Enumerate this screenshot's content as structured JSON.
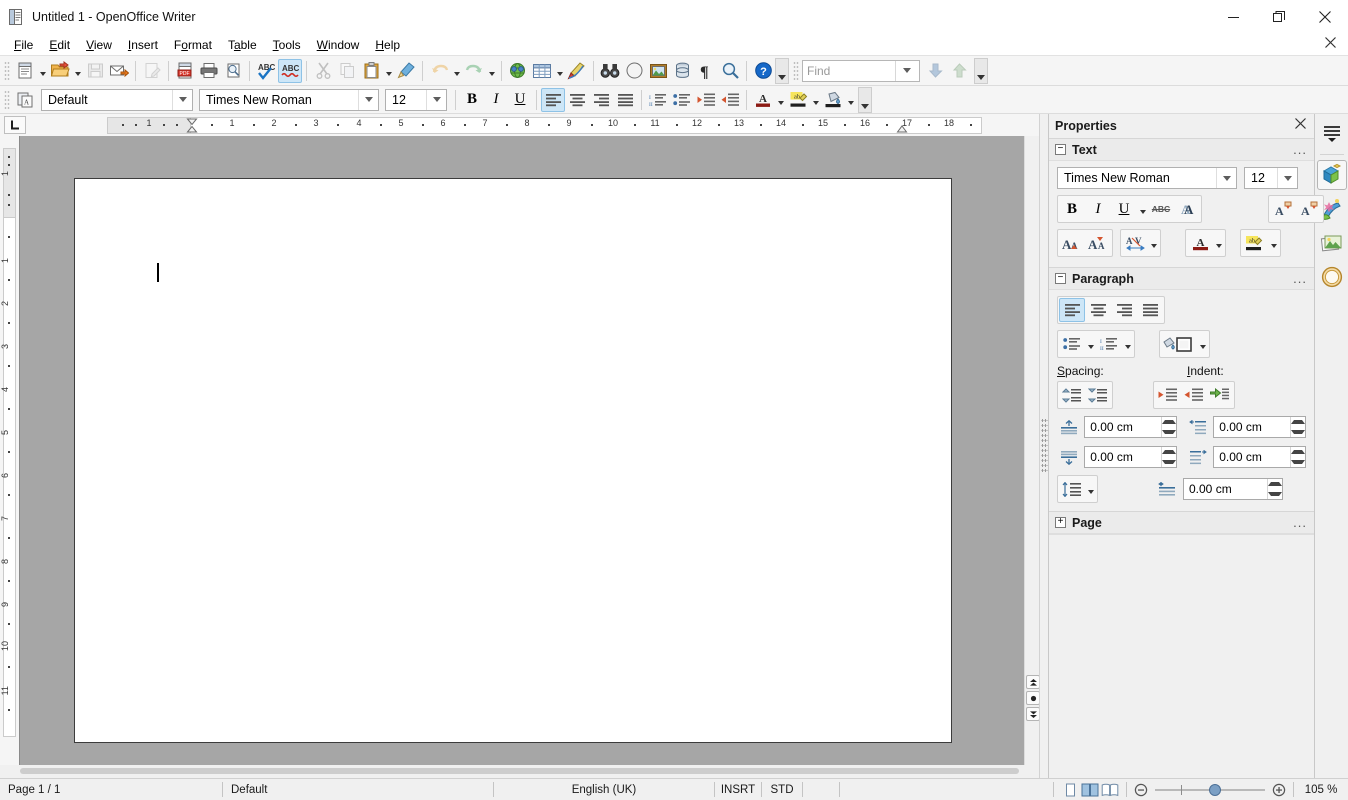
{
  "window": {
    "title": "Untitled 1 - OpenOffice Writer",
    "app_icon": "writer-document-icon",
    "minimize_label": "Minimize",
    "restore_label": "Restore",
    "close_label": "Close",
    "doc_close_label": "Close Document"
  },
  "menubar": {
    "items": [
      {
        "label": "File",
        "accel": "F"
      },
      {
        "label": "Edit",
        "accel": "E"
      },
      {
        "label": "View",
        "accel": "V"
      },
      {
        "label": "Insert",
        "accel": "I"
      },
      {
        "label": "Format",
        "accel": "o"
      },
      {
        "label": "Table",
        "accel": "a"
      },
      {
        "label": "Tools",
        "accel": "T"
      },
      {
        "label": "Window",
        "accel": "W"
      },
      {
        "label": "Help",
        "accel": "H"
      }
    ]
  },
  "standard_toolbar": {
    "items": [
      {
        "name": "new-document-button",
        "tip": "New",
        "icon": "new-doc-icon",
        "dropdown": true,
        "state": "enabled"
      },
      {
        "name": "open-button",
        "tip": "Open",
        "icon": "open-folder-icon",
        "dropdown": true,
        "state": "enabled"
      },
      {
        "name": "save-button",
        "tip": "Save",
        "icon": "floppy-disk-icon",
        "state": "disabled"
      },
      {
        "name": "email-document-button",
        "tip": "E-mail Document",
        "icon": "envelope-arrow-icon",
        "state": "enabled"
      },
      {
        "name": "edit-file-button",
        "tip": "Edit File",
        "icon": "pencil-page-icon",
        "state": "disabled"
      },
      {
        "name": "export-pdf-button",
        "tip": "Export Directly as PDF",
        "icon": "pdf-icon",
        "state": "enabled"
      },
      {
        "name": "print-button",
        "tip": "Print File Directly",
        "icon": "printer-icon",
        "state": "enabled"
      },
      {
        "name": "print-preview-button",
        "tip": "Page Preview",
        "icon": "page-preview-icon",
        "state": "enabled"
      },
      {
        "name": "spelling-button",
        "tip": "Spelling and Grammar",
        "icon": "abc-check-icon",
        "state": "enabled"
      },
      {
        "name": "autospellcheck-button",
        "tip": "AutoSpellcheck",
        "icon": "abc-underline-icon",
        "state": "active"
      },
      {
        "name": "cut-button",
        "tip": "Cut",
        "icon": "scissors-icon",
        "state": "disabled"
      },
      {
        "name": "copy-button",
        "tip": "Copy",
        "icon": "copy-icon",
        "state": "disabled"
      },
      {
        "name": "paste-button",
        "tip": "Paste",
        "icon": "clipboard-icon",
        "dropdown": true,
        "state": "enabled"
      },
      {
        "name": "clone-formatting-button",
        "tip": "Clone Formatting",
        "icon": "paintbrush-icon",
        "state": "enabled"
      },
      {
        "name": "undo-button",
        "tip": "Undo",
        "icon": "undo-arrow-icon",
        "dropdown": true,
        "state": "disabled"
      },
      {
        "name": "redo-button",
        "tip": "Redo",
        "icon": "redo-arrow-icon",
        "dropdown": true,
        "state": "disabled"
      },
      {
        "name": "hyperlink-button",
        "tip": "Hyperlink",
        "icon": "globe-icon",
        "state": "enabled"
      },
      {
        "name": "insert-table-button",
        "tip": "Table",
        "icon": "table-grid-icon",
        "dropdown": true,
        "state": "enabled"
      },
      {
        "name": "show-draw-functions-button",
        "tip": "Show Draw Functions",
        "icon": "pencil-draw-icon",
        "state": "enabled"
      },
      {
        "name": "find-replace-button",
        "tip": "Find & Replace",
        "icon": "binoculars-icon",
        "state": "enabled"
      },
      {
        "name": "navigator-button",
        "tip": "Navigator",
        "icon": "compass-icon",
        "state": "enabled"
      },
      {
        "name": "gallery-button",
        "tip": "Gallery",
        "icon": "picture-frame-icon",
        "state": "enabled"
      },
      {
        "name": "data-sources-button",
        "tip": "Data Sources",
        "icon": "database-icon",
        "state": "enabled"
      },
      {
        "name": "formatting-marks-button",
        "tip": "Formatting Marks",
        "icon": "pilcrow-icon",
        "state": "enabled"
      },
      {
        "name": "zoom-button",
        "tip": "Zoom",
        "icon": "magnifier-icon",
        "state": "enabled"
      },
      {
        "name": "help-button",
        "tip": "OpenOffice Help",
        "icon": "help-circle-icon",
        "state": "enabled"
      }
    ],
    "find": {
      "name": "find-toolbar-input",
      "placeholder": "Find",
      "value": "",
      "find-next-label": "Find Next",
      "find-previous-label": "Find Previous"
    }
  },
  "formatting_toolbar": {
    "paragraph_style": {
      "value": "Default",
      "name": "paragraph-style-combo"
    },
    "font_name": {
      "value": "Times New Roman",
      "name": "font-name-combo"
    },
    "font_size": {
      "value": "12",
      "name": "font-size-combo"
    },
    "buttons": [
      {
        "name": "bold-button",
        "label": "B",
        "state": "enabled"
      },
      {
        "name": "italic-button",
        "label": "I",
        "state": "enabled"
      },
      {
        "name": "underline-button",
        "label": "U",
        "state": "enabled"
      },
      {
        "name": "align-left-button",
        "label": "Align Left",
        "state": "active"
      },
      {
        "name": "align-center-button",
        "label": "Centered",
        "state": "enabled"
      },
      {
        "name": "align-right-button",
        "label": "Align Right",
        "state": "enabled"
      },
      {
        "name": "justified-button",
        "label": "Justified",
        "state": "enabled"
      },
      {
        "name": "ordered-list-button",
        "label": "Numbering On/Off",
        "state": "enabled"
      },
      {
        "name": "unordered-list-button",
        "label": "Bullets On/Off",
        "state": "enabled"
      },
      {
        "name": "increase-indent-button",
        "label": "Increase Indent",
        "state": "enabled"
      },
      {
        "name": "decrease-indent-button",
        "label": "Decrease Indent",
        "state": "enabled"
      },
      {
        "name": "font-color-button",
        "label": "Font Color",
        "state": "enabled"
      },
      {
        "name": "highlighting-button",
        "label": "Highlighting",
        "state": "enabled"
      },
      {
        "name": "background-color-button",
        "label": "Background Color",
        "state": "enabled"
      }
    ]
  },
  "ruler": {
    "horizontal_unit": "cm",
    "horizontal_ticks": [
      "1",
      "1",
      "2",
      "3",
      "4",
      "5",
      "6",
      "7",
      "8",
      "9",
      "10",
      "11",
      "12",
      "13",
      "14",
      "15",
      "16",
      "17",
      "18"
    ],
    "vertical_ticks": [
      "1",
      "1",
      "2",
      "3",
      "4",
      "5",
      "6",
      "7",
      "8",
      "9",
      "10",
      "11"
    ],
    "tab_selector": "left-tab-stop"
  },
  "document": {
    "page_label": "blank-page",
    "content": "",
    "caret_visible": true
  },
  "sidebar": {
    "title": "Properties",
    "close_label": "Close Sidebar Deck",
    "panels": [
      {
        "name": "text-panel",
        "title": "Text",
        "expanded": true,
        "more_options": "...",
        "font_name": {
          "value": "Times New Roman",
          "name": "sidebar-font-name-combo"
        },
        "font_size": {
          "value": "12",
          "name": "sidebar-font-size-combo"
        },
        "buttons": [
          {
            "name": "sidebar-bold-button",
            "label": "B"
          },
          {
            "name": "sidebar-italic-button",
            "label": "I"
          },
          {
            "name": "sidebar-underline-button",
            "label": "U"
          },
          {
            "name": "sidebar-strikethrough-button",
            "label": "ABC"
          },
          {
            "name": "sidebar-shadow-button",
            "label": "A"
          },
          {
            "name": "sidebar-superscript-button",
            "label": "Superscript"
          },
          {
            "name": "sidebar-subscript-button",
            "label": "Subscript"
          },
          {
            "name": "sidebar-increase-font-button",
            "label": "Increase Font Size"
          },
          {
            "name": "sidebar-decrease-font-button",
            "label": "Decrease Font Size"
          },
          {
            "name": "sidebar-character-spacing-button",
            "label": "Character Spacing"
          },
          {
            "name": "sidebar-font-color-button",
            "label": "Font Color"
          },
          {
            "name": "sidebar-highlighting-button",
            "label": "Highlighting"
          }
        ]
      },
      {
        "name": "paragraph-panel",
        "title": "Paragraph",
        "expanded": true,
        "more_options": "...",
        "align_buttons": [
          {
            "name": "sidebar-align-left-button",
            "label": "Align Left",
            "state": "active"
          },
          {
            "name": "sidebar-align-center-button",
            "label": "Center",
            "state": "enabled"
          },
          {
            "name": "sidebar-align-right-button",
            "label": "Align Right",
            "state": "enabled"
          },
          {
            "name": "sidebar-justify-button",
            "label": "Justified",
            "state": "enabled"
          }
        ],
        "list_buttons": [
          {
            "name": "sidebar-bullet-list-button",
            "label": "Unordered List"
          },
          {
            "name": "sidebar-numbered-list-button",
            "label": "Ordered List"
          },
          {
            "name": "sidebar-paragraph-background-button",
            "label": "Paragraph Background"
          }
        ],
        "spacing_label": "Spacing:",
        "spacing_accel": "S",
        "indent_label": "Indent:",
        "indent_accel": "I",
        "spacing_toggle_buttons": [
          {
            "name": "increase-paragraph-spacing-button",
            "label": "Increase Paragraph Spacing"
          },
          {
            "name": "decrease-paragraph-spacing-button",
            "label": "Decrease Paragraph Spacing"
          }
        ],
        "indent_toggle_buttons": [
          {
            "name": "increase-indent-sidebar-button",
            "label": "Increase Indent"
          },
          {
            "name": "decrease-indent-sidebar-button",
            "label": "Decrease Indent"
          },
          {
            "name": "hanging-indent-button",
            "label": "Switch to Hanging Indent"
          }
        ],
        "fields": [
          {
            "name": "above-paragraph-spacing-field",
            "label": "Above Paragraph Spacing",
            "value": "0.00 cm"
          },
          {
            "name": "below-paragraph-spacing-field",
            "label": "Below Paragraph Spacing",
            "value": "0.00 cm"
          },
          {
            "name": "before-text-indent-field",
            "label": "Before Text Indent",
            "value": "0.00 cm"
          },
          {
            "name": "after-text-indent-field",
            "label": "After Text Indent",
            "value": "0.00 cm"
          },
          {
            "name": "first-line-indent-field",
            "label": "First Line Indent",
            "value": "0.00 cm"
          }
        ],
        "line_spacing_button": {
          "name": "line-spacing-button",
          "label": "Line Spacing"
        }
      },
      {
        "name": "page-panel",
        "title": "Page",
        "expanded": false,
        "more_options": "..."
      }
    ],
    "rail": [
      {
        "name": "sidebar-settings-button",
        "icon": "hamburger-menu-icon",
        "selected": false
      },
      {
        "name": "sidebar-tab-properties",
        "icon": "properties-cube-icon",
        "selected": true
      },
      {
        "name": "sidebar-tab-styles",
        "icon": "styles-paint-icon",
        "selected": false
      },
      {
        "name": "sidebar-tab-gallery",
        "icon": "gallery-photos-icon",
        "selected": false
      },
      {
        "name": "sidebar-tab-navigator",
        "icon": "navigator-compass-icon",
        "selected": false
      }
    ]
  },
  "statusbar": {
    "page": "Page 1 / 1",
    "page_style": "Default",
    "language": "English (UK)",
    "insert_mode": "INSRT",
    "selection_mode": "STD",
    "modified": "",
    "digital_signature": "",
    "view_buttons": [
      {
        "name": "single-page-view-button",
        "label": "Single-page view",
        "selected": false
      },
      {
        "name": "multi-page-view-button",
        "label": "Multiple-page view",
        "selected": true
      },
      {
        "name": "book-view-button",
        "label": "Book view",
        "selected": false
      }
    ],
    "zoom_out_label": "Zoom Out",
    "zoom_in_label": "Zoom In",
    "zoom_value": "105 %"
  },
  "colors": {
    "accent": "#cde6f7",
    "accent_border": "#8ec2e6",
    "canvas": "#a6a6a6",
    "chrome": "#f0f0f0",
    "toolbar": "#f5f5f5"
  }
}
